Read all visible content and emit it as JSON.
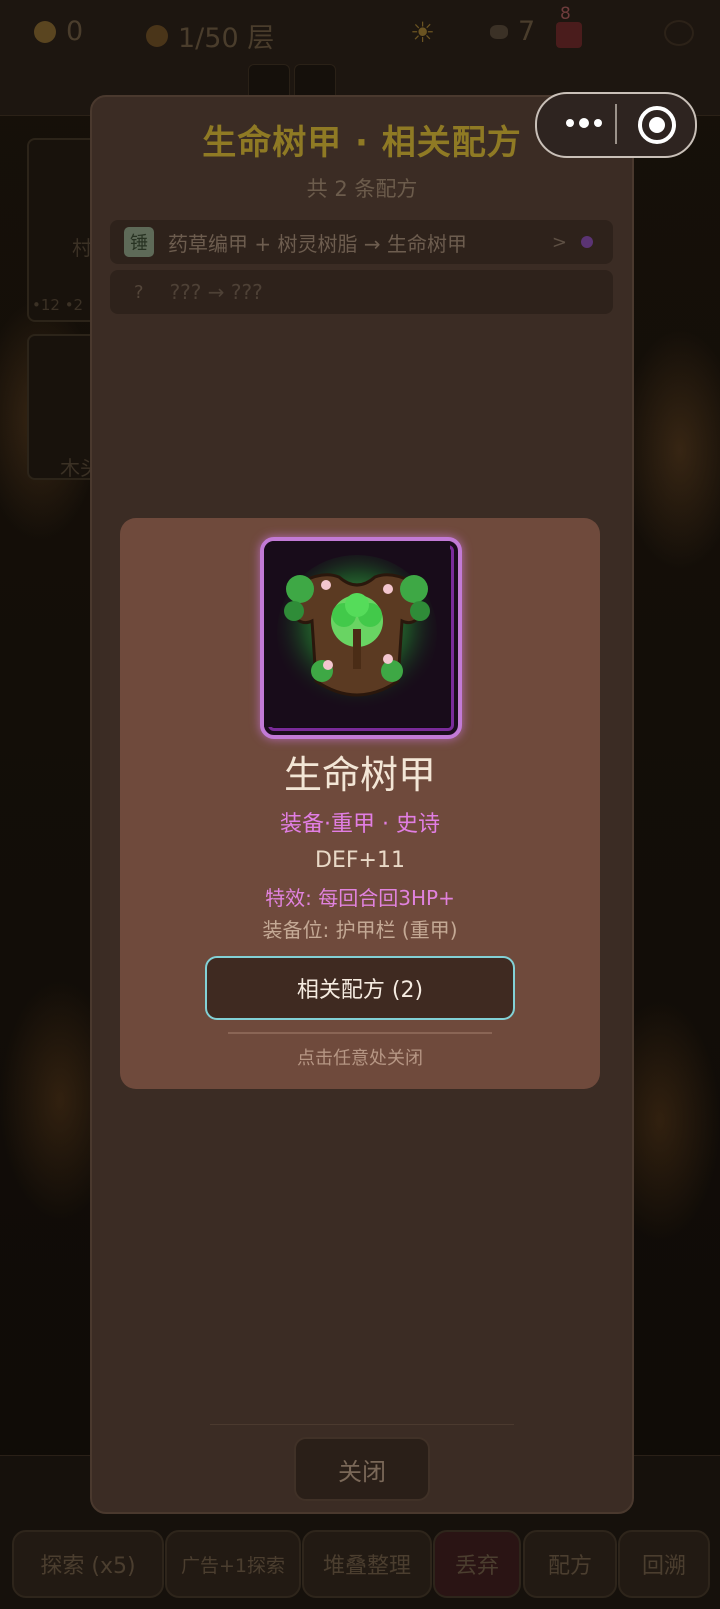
{
  "topbar": {
    "coins": "0",
    "floor": "1/50 层",
    "gems": "7",
    "gift_badge": "8"
  },
  "bottom_buttons": [
    {
      "label": "探索 (x5)"
    },
    {
      "label": "广告+1探索"
    },
    {
      "label": "堆叠整理"
    },
    {
      "label": "丢弃"
    },
    {
      "label": "配方"
    },
    {
      "label": "回溯"
    }
  ],
  "side": {
    "card1_label": "村",
    "card1_stats": "•12 •2",
    "card2_label": "木头"
  },
  "recipe_panel": {
    "title": "生命树甲 · 相关配方",
    "count": "共 2 条配方",
    "recipes": [
      {
        "tag": "锤",
        "text": "药草编甲 + 树灵树脂 → 生命树甲",
        "arrow": ">"
      },
      {
        "tag": "?",
        "text": "??? → ???"
      }
    ],
    "close_label": "关闭"
  },
  "item_modal": {
    "name": "生命树甲",
    "type": "装备·重甲 · 史诗",
    "stat": "DEF+11",
    "effect": "特效: 每回合回3HP+",
    "slot": "装备位: 护甲栏 (重甲)",
    "related_button": "相关配方 (2)",
    "hint": "点击任意处关闭",
    "rarity_color": "#c27ad6"
  },
  "colors": {
    "title_gold": "#8f7a24",
    "epic_purple": "#e17ee3",
    "button_border": "#82d1d6"
  }
}
